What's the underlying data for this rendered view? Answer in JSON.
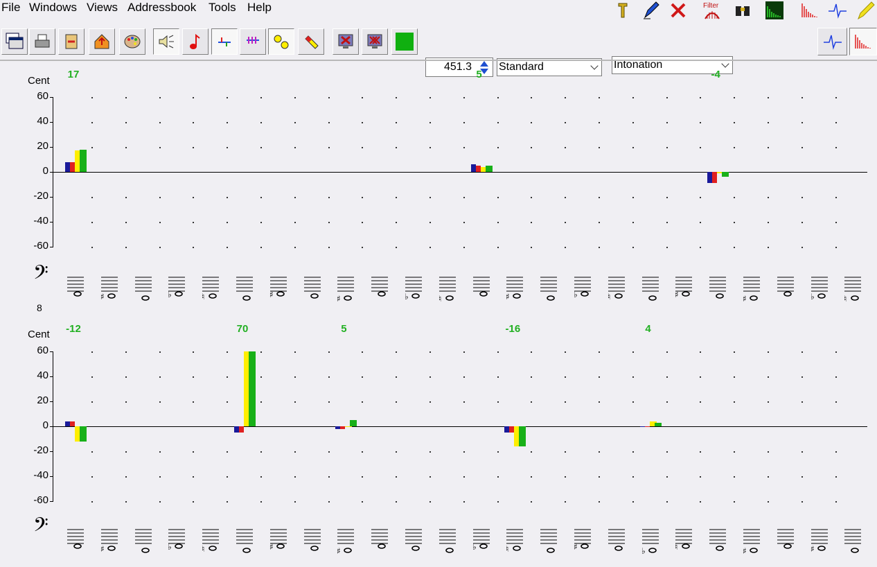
{
  "menu": [
    "File",
    "Windows",
    "Views",
    "Addressbook",
    "Tools",
    "Help"
  ],
  "top_icons": [
    "tuning-fork-icon",
    "pen-icon",
    "close-x-icon",
    "filter-icon",
    "binoculars-icon",
    "spectrum-green-icon",
    "spectrum-red-icon",
    "waveform-blue-icon",
    "pencil-yellow-icon"
  ],
  "top_icon_filter_label": "Filter",
  "toolbar": {
    "freq_value": "451.3",
    "preset": "Standard",
    "mode": "Intonation"
  },
  "colors": {
    "series": [
      "#1a1a9a",
      "#e02020",
      "#ffee00",
      "#18b018"
    ],
    "label_green": "#22b022"
  },
  "cent_label": "Cent",
  "octave_label": "8",
  "tick_labels": [
    "60",
    "40",
    "20",
    "0",
    "-20",
    "-40",
    "-60"
  ],
  "chart_data": [
    {
      "type": "bar",
      "ylabel": "Cent",
      "ylim": [
        -60,
        60
      ],
      "yticks": [
        60,
        40,
        20,
        0,
        -20,
        -40,
        -60
      ],
      "note_slots": 24,
      "groups": [
        {
          "slot": 0,
          "label": "17",
          "values": [
            8,
            8,
            17,
            18
          ]
        },
        {
          "slot": 12,
          "label": "5",
          "values": [
            6,
            5,
            4,
            5
          ]
        },
        {
          "slot": 19,
          "label": "-4",
          "values": [
            -9,
            -9,
            -1,
            -4
          ]
        }
      ]
    },
    {
      "type": "bar",
      "ylabel": "Cent",
      "ylim": [
        -60,
        60
      ],
      "yticks": [
        60,
        40,
        20,
        0,
        -20,
        -40,
        -60
      ],
      "note_slots": 24,
      "groups": [
        {
          "slot": 0,
          "label": "-12",
          "values": [
            4,
            4,
            -12,
            -12
          ]
        },
        {
          "slot": 5,
          "label": "70",
          "values": [
            -5,
            -5,
            60,
            60
          ]
        },
        {
          "slot": 8,
          "label": "5",
          "values": [
            -2,
            -2,
            0,
            5
          ]
        },
        {
          "slot": 13,
          "label": "-16",
          "values": [
            -5,
            -5,
            -16,
            -16
          ]
        },
        {
          "slot": 17,
          "label": "4",
          "values": [
            0,
            0,
            4,
            3
          ]
        }
      ]
    }
  ],
  "staves": [
    {
      "clef": "bass",
      "accidentals": [
        "",
        "#",
        "",
        "b",
        "n",
        "",
        "#",
        "",
        "#",
        "",
        "b",
        "n",
        "",
        "#",
        "",
        "b",
        "n",
        "",
        "#",
        "",
        "#",
        "",
        "b",
        "n"
      ]
    },
    {
      "clef": "bass",
      "accidentals": [
        "",
        "#",
        "",
        "b",
        "n",
        "",
        "#",
        "",
        "#",
        "",
        "",
        "",
        "b",
        "n",
        "",
        "#",
        "",
        "b",
        "n",
        "",
        "#",
        "",
        "#",
        "",
        "b"
      ]
    }
  ]
}
